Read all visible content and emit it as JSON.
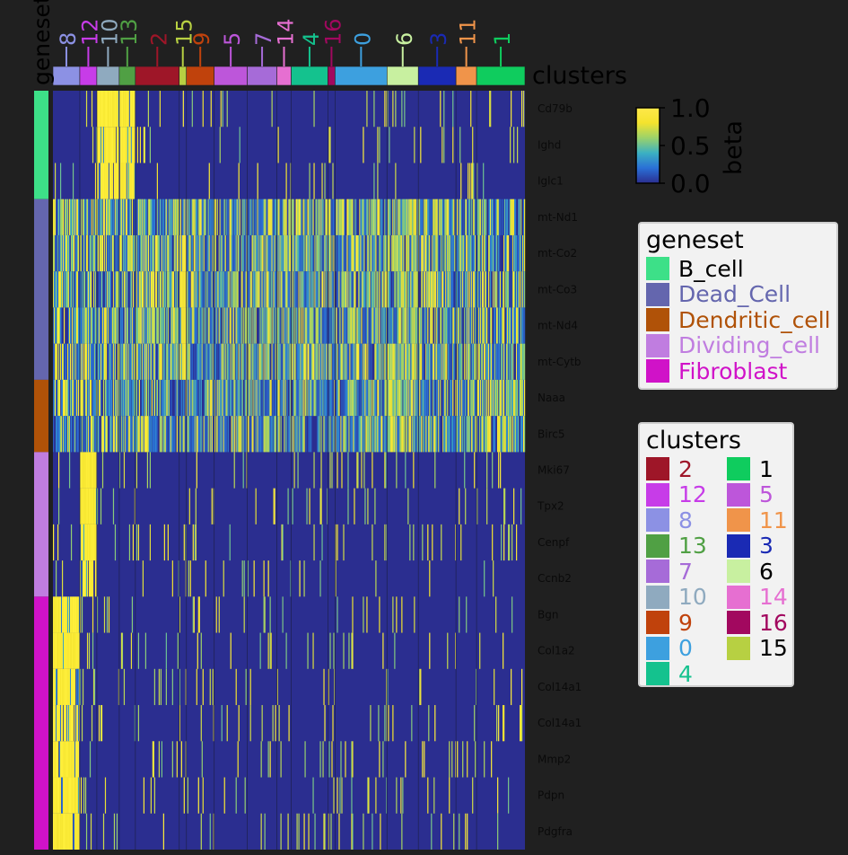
{
  "chart_data": {
    "type": "heatmap",
    "title": "",
    "xlabel": "clusters",
    "ylabel": "geneset",
    "column_clusters": [
      {
        "id": "8",
        "color": "#8c91e4",
        "cells": 30
      },
      {
        "id": "12",
        "color": "#c73ce8",
        "cells": 19
      },
      {
        "id": "10",
        "color": "#8faabf",
        "cells": 25
      },
      {
        "id": "13",
        "color": "#50a044",
        "cells": 18
      },
      {
        "id": "2",
        "color": "#9e1628",
        "cells": 49
      },
      {
        "id": "15",
        "color": "#b7d042",
        "cells": 8
      },
      {
        "id": "9",
        "color": "#c0420c",
        "cells": 31
      },
      {
        "id": "5",
        "color": "#bd56da",
        "cells": 37
      },
      {
        "id": "7",
        "color": "#a66bd8",
        "cells": 33
      },
      {
        "id": "14",
        "color": "#e66fd1",
        "cells": 16
      },
      {
        "id": "4",
        "color": "#14c28e",
        "cells": 41
      },
      {
        "id": "16",
        "color": "#a2085f",
        "cells": 8
      },
      {
        "id": "0",
        "color": "#3da0df",
        "cells": 58
      },
      {
        "id": "6",
        "color": "#c8f0a0",
        "cells": 35
      },
      {
        "id": "3",
        "color": "#1a2ab4",
        "cells": 42
      },
      {
        "id": "11",
        "color": "#f0944a",
        "cells": 23
      },
      {
        "id": "1",
        "color": "#0fcc5e",
        "cells": 54
      }
    ],
    "genes": [
      {
        "name": "Cd79b",
        "geneset": "B_cell"
      },
      {
        "name": "Ighd",
        "geneset": "B_cell"
      },
      {
        "name": "Iglc1",
        "geneset": "B_cell"
      },
      {
        "name": "mt-Nd1",
        "geneset": "Dead_Cell"
      },
      {
        "name": "mt-Co2",
        "geneset": "Dead_Cell"
      },
      {
        "name": "mt-Co3",
        "geneset": "Dead_Cell"
      },
      {
        "name": "mt-Nd4",
        "geneset": "Dead_Cell"
      },
      {
        "name": "mt-Cytb",
        "geneset": "Dead_Cell"
      },
      {
        "name": "Naaa",
        "geneset": "Dendritic_cell"
      },
      {
        "name": "Birc5",
        "geneset": "Dendritic_cell"
      },
      {
        "name": "Mki67",
        "geneset": "Dividing_cell"
      },
      {
        "name": "Tpx2",
        "geneset": "Dividing_cell"
      },
      {
        "name": "Cenpf",
        "geneset": "Dividing_cell"
      },
      {
        "name": "Ccnb2",
        "geneset": "Dividing_cell"
      },
      {
        "name": "Bgn",
        "geneset": "Fibroblast"
      },
      {
        "name": "Col1a2",
        "geneset": "Fibroblast"
      },
      {
        "name": "Col14a1",
        "geneset": "Fibroblast"
      },
      {
        "name": "Col14a1",
        "geneset": "Fibroblast"
      },
      {
        "name": "Mmp2",
        "geneset": "Fibroblast"
      },
      {
        "name": "Pdpn",
        "geneset": "Fibroblast"
      },
      {
        "name": "Pdgfra",
        "geneset": "Fibroblast"
      }
    ],
    "genesets": [
      {
        "name": "B_cell",
        "color": "#3de088"
      },
      {
        "name": "Dead_Cell",
        "color": "#6466ae"
      },
      {
        "name": "Dendritic_cell",
        "color": "#b05208"
      },
      {
        "name": "Dividing_cell",
        "color": "#c07de0"
      },
      {
        "name": "Fibroblast",
        "color": "#d012c8"
      }
    ],
    "enrichment": {
      "B_cell": {
        "10": 0.92,
        "13": 0.88,
        "12": 0.08,
        "default": 0.03
      },
      "Dead_Cell": {
        "15": 0.95,
        "6": 0.72,
        "default": 0.45
      },
      "Dendritic_cell": {
        "6": 0.7,
        "1": 0.6,
        "11": 0.55,
        "default": 0.35
      },
      "Dividing_cell": {
        "12": 0.95,
        "default": 0.04
      },
      "Fibroblast": {
        "8": 0.93,
        "default": 0.04
      }
    },
    "colorbar": {
      "label": "beta",
      "min": 0.0,
      "max": 1.0,
      "ticks": [
        "0.0",
        "0.5",
        "1.0"
      ],
      "colors": [
        "#2b2e90",
        "#2a6fd6",
        "#3bb0c2",
        "#9bd26a",
        "#f4e32e",
        "#ffe84a"
      ]
    },
    "legend_geneset_title": "geneset",
    "legend_clusters_title": "clusters",
    "legend_clusters_order": [
      "2",
      "1",
      "12",
      "5",
      "8",
      "11",
      "13",
      "3",
      "7",
      "6",
      "10",
      "14",
      "9",
      "16",
      "0",
      "15",
      "4"
    ]
  }
}
